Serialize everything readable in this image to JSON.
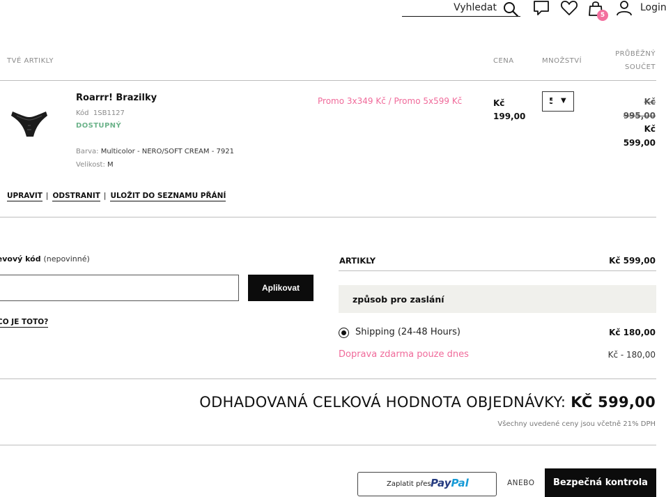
{
  "header": {
    "search_label": "Vyhledat",
    "cart_count": "5",
    "login_label": "Login"
  },
  "table": {
    "col_items": "TVÉ ARTIKLY",
    "col_price": "CENA",
    "col_qty": "MNOŽSTVÍ",
    "col_subtotal_1": "PRŮBĚŽNÝ",
    "col_subtotal_2": "SOUČET"
  },
  "product": {
    "name": "Roarrr! Brazilky",
    "code_label": "Kód",
    "code": "1SB1127",
    "stock": "DOSTUPNÝ",
    "color_label": "Barva:",
    "color": "Multicolor - NERO/SOFT CREAM - 7921",
    "size_label": "Velikost:",
    "size": "M",
    "promo": "Promo 3x349 Kč / Promo 5x599 Kč",
    "price_currency": "Kč",
    "price_value": "199,00",
    "qty": "5",
    "subtotal_old_currency": "Kč",
    "subtotal_old_value": "995,00",
    "subtotal_new_currency": "Kč",
    "subtotal_new_value": "599,00",
    "action_edit": "UPRAVIT",
    "action_remove": "ODSTRANIT",
    "action_wishlist": "ULOŽIT DO SEZNAMU PŘÁNÍ"
  },
  "promo_code": {
    "label": "levový kód",
    "optional": "(nepovinné)",
    "input_value": "",
    "apply_label": "Aplikovat",
    "what_link": "CO JE TOTO?"
  },
  "summary": {
    "items_label": "ARTIKLY",
    "items_value": "Kč 599,00",
    "shipping_title": "způsob pro zaslání",
    "shipping_option": "Shipping (24-48 Hours)",
    "shipping_price": "Kč 180,00",
    "free_label": "Doprava zdarma pouze dnes",
    "free_value": "Kč - 180,00",
    "total_label": "ODHADOVANÁ CELKOVÁ HODNOTA OBJEDNÁVKY:",
    "total_value": "KČ 599,00",
    "vat_note": "Všechny uvedené ceny jsou včetně 21% DPH"
  },
  "checkout": {
    "paypal_prefix": "Zaplatit přes",
    "paypal_brand_1": "Pay",
    "paypal_brand_2": "Pal",
    "or_label": "ANEBO",
    "secure_checkout": "Bezpečná kontrola"
  },
  "colors": {
    "accent_pink": "#f06a9a",
    "stock_green": "#6cb38a",
    "button_black": "#0c0c0c"
  }
}
